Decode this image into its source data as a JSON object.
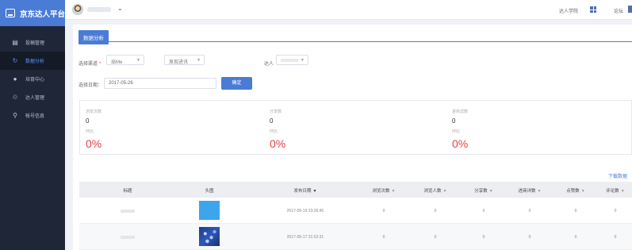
{
  "app": {
    "brand": "京东达人平台"
  },
  "sidebar": {
    "items": [
      {
        "label": "投稿管理",
        "icon": "document-icon"
      },
      {
        "label": "数据分析",
        "icon": "refresh-icon",
        "active": true
      },
      {
        "label": "培育中心",
        "icon": "info-circle-icon"
      },
      {
        "label": "达人管理",
        "icon": "recycle-icon"
      },
      {
        "label": "帐号信息",
        "icon": "user-icon"
      }
    ]
  },
  "topbar": {
    "link_1": "达人学院",
    "link_2": "论坛"
  },
  "page": {
    "tab_label": "数据分析"
  },
  "filters": {
    "channel_label": "选择渠道",
    "required_mark": "*",
    "channel_value": "出Me",
    "type_value": "发现进讯",
    "talent_label": "达人",
    "date_label": "选择日期：",
    "date_value": "2017-05-26",
    "confirm_label": "确定"
  },
  "stats": [
    {
      "label": "浏览次数",
      "value": "0",
      "sub_label": "环比",
      "change": "0%"
    },
    {
      "label": "分享数",
      "value": "0",
      "sub_label": "环比",
      "change": "0%"
    },
    {
      "label": "进商详数",
      "value": "0",
      "sub_label": "环比",
      "change": "0%"
    }
  ],
  "download_label": "下载数据",
  "table": {
    "headers": [
      "标题",
      "头图",
      "发布日期",
      "浏览次数",
      "浏览人数",
      "分享数",
      "进商详数",
      "点赞数",
      "评论数"
    ],
    "sort_mark": "▼",
    "rows": [
      {
        "date": "2017-05-19 23:26:45",
        "views": "0",
        "visitors": "0",
        "shares": "0",
        "details": "0",
        "likes": "0",
        "comments": "0"
      },
      {
        "date": "2017-05-17 21:52:31",
        "views": "0",
        "visitors": "0",
        "shares": "0",
        "details": "0",
        "likes": "0",
        "comments": "0"
      }
    ]
  },
  "colors": {
    "accent": "#4a7cd6",
    "sidebar": "#1f2637",
    "negative": "#e64242"
  }
}
